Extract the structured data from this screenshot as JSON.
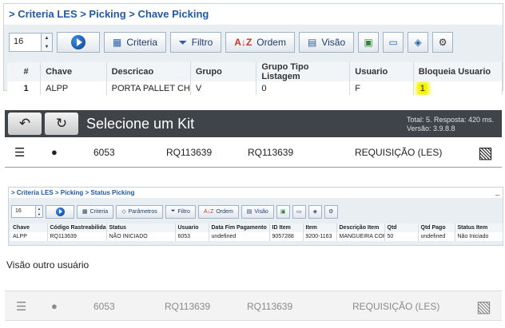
{
  "panel1": {
    "breadcrumb": "> Criteria LES > Picking > Chave Picking",
    "spinner_value": "16",
    "toolbar": {
      "criteria_label": "Criteria",
      "filtro_label": "Filtro",
      "ordem_label": "Ordem",
      "visao_label": "Visão"
    },
    "table": {
      "headers": [
        "#",
        "Chave",
        "Descricao",
        "Grupo",
        "Grupo Tipo Listagem",
        "Usuario",
        "Bloqueia Usuario"
      ],
      "rows": [
        [
          "1",
          "ALPP",
          "PORTA PALLET CH",
          "V",
          "0",
          "F",
          "1"
        ]
      ]
    }
  },
  "panel2": {
    "title": "Selecione um Kit",
    "info_line1": "Total: 5. Resposta: 420 ms.",
    "info_line2": "Versão: 3.9.8.8",
    "row": {
      "number": "6053",
      "req1": "RQ113639",
      "req2": "RQ113639",
      "type": "REQUISIÇÃO (LES)"
    }
  },
  "panel3": {
    "breadcrumb": "> Criteria LES > Picking > Status Picking",
    "minimize": "_",
    "spinner_value": "16",
    "toolbar": {
      "criteria_label": "Criteria",
      "parametros_label": "Parâmetros",
      "filtro_label": "Filtro",
      "ordem_label": "Ordem",
      "visao_label": "Visão"
    },
    "table": {
      "headers": [
        "Chave",
        "Código Rastreabilida",
        "Status",
        "Usuario",
        "Data Fim Pagamento",
        "ID Item",
        "Item",
        "Descrição Item",
        "Qtd",
        "Qtd Pago",
        "Status Item"
      ],
      "rows": [
        [
          "ALPP",
          "RQ113639",
          "NÃO INICIADO",
          "6053",
          "undefined",
          "9057288",
          "9200-1163",
          "MANGUEIRA CORR",
          "50",
          "undefined",
          "Não Iniciado"
        ]
      ]
    }
  },
  "caption": "Visão outro  usuário",
  "panel4": {
    "row": {
      "number": "6053",
      "req1": "RQ113639",
      "req2": "RQ113639",
      "type": "REQUISIÇÃO (LES)"
    }
  },
  "colors": {
    "breadcrumb_blue": "#1f5aa6",
    "highlight_yellow": "#f3f200",
    "dark_bar": "#404448"
  }
}
